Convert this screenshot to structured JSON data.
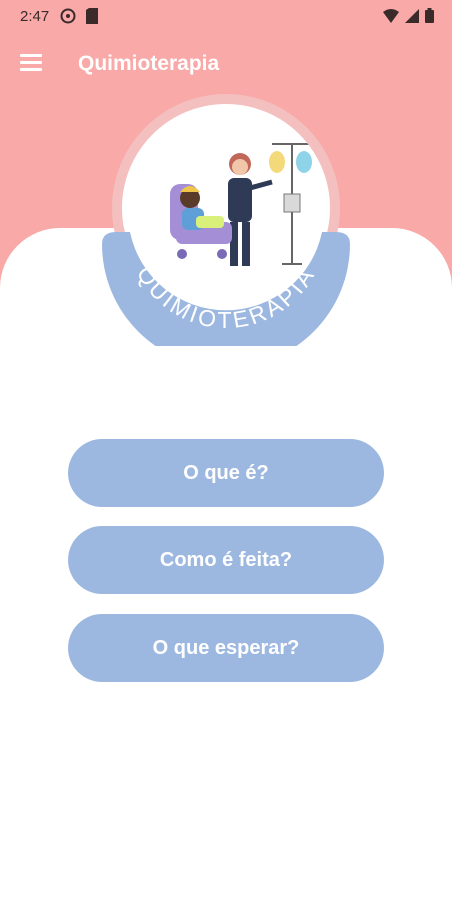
{
  "status_bar": {
    "time": "2:47"
  },
  "app_bar": {
    "title": "Quimioterapia",
    "menu_icon": "hamburger-menu-icon"
  },
  "logo": {
    "text": "QUIMIOTERAPIA"
  },
  "buttons": [
    {
      "label": "O que é?"
    },
    {
      "label": "Como é feita?"
    },
    {
      "label": "O que esperar?"
    }
  ],
  "colors": {
    "header": "#f8a9a8",
    "button": "#9db8e0",
    "band": "#9db8e0",
    "background": "#ffffff"
  }
}
